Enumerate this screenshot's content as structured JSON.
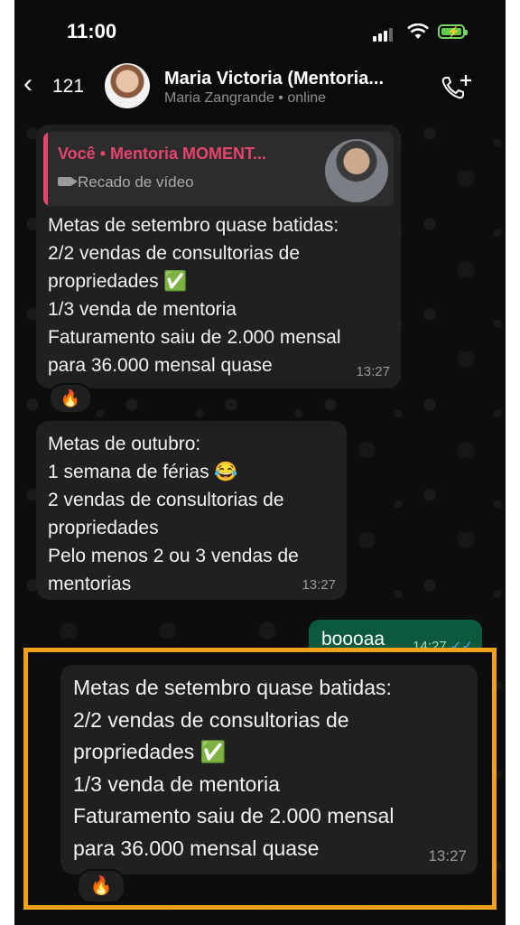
{
  "status_bar": {
    "time": "11:00"
  },
  "header": {
    "back_label": "<",
    "back_count": "121",
    "title": "Maria Victoria (Mentoria...",
    "subtitle": "Maria Zangrande",
    "status": "• online",
    "add_call_icon": "phone-plus-icon"
  },
  "messages": [
    {
      "quote_title": "Você • Mentoria MOMENT...",
      "quote_subtitle": "Recado de vídeo",
      "text": "Metas de setembro quase batidas:\n2/2 vendas de consultorias de\npropriedades ✅\n1/3 venda de mentoria\nFaturamento saiu de 2.000 mensal\npara 36.000 mensal quase",
      "time": "13:27",
      "reaction": "🔥"
    },
    {
      "text": "Metas de outubro:\n1 semana de férias 😂\n2 vendas de consultorias de\npropriedades\nPelo menos 2 ou 3 vendas de\nmentorias",
      "time": "13:27"
    },
    {
      "text": "boooaa",
      "time": "14:27",
      "ticks": "✓✓"
    }
  ],
  "highlighted_message": {
    "text": "Metas de setembro quase batidas:\n2/2 vendas de consultorias de\npropriedades ✅\n1/3 venda de mentoria\nFaturamento saiu de 2.000 mensal\npara 36.000 mensal quase",
    "time": "13:27",
    "reaction": "🔥",
    "border_color": "#f3a21a"
  },
  "colors": {
    "quote_accent": "#e5446d",
    "outgoing_bubble": "#0c5a3e",
    "read_ticks": "#54a6ff"
  }
}
